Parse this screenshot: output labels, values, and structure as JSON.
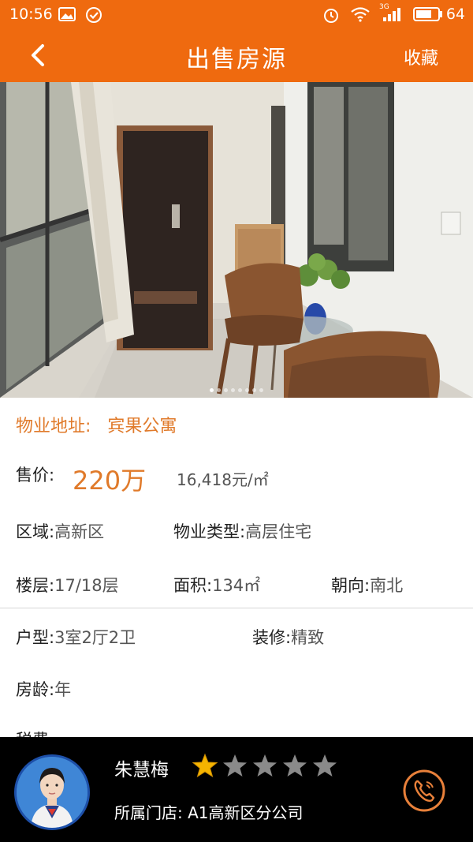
{
  "status_bar": {
    "time": "10:56",
    "network": "3G",
    "battery": "64"
  },
  "header": {
    "title": "出售房源",
    "favorite_label": "收藏",
    "back_icon": "chevron-left-icon",
    "color": "#ef6a0f"
  },
  "gallery": {
    "image_count": 8,
    "active_index": 1
  },
  "property": {
    "address_label": "物业地址:",
    "address_value": "宾果公寓",
    "price_label": "售价:",
    "price_value": "220万",
    "unit_price": "16,418元/㎡",
    "district_label": "区域:",
    "district_value": "高新区",
    "type_label": "物业类型:",
    "type_value": "高层住宅",
    "floor_label": "楼层:",
    "floor_value": "17/18层",
    "area_label": "面积:",
    "area_value": "134㎡",
    "orientation_label": "朝向:",
    "orientation_value": "南北",
    "layout_label": "户型:",
    "layout_value": "3室2厅2卫",
    "decoration_label": "装修:",
    "decoration_value": "精致",
    "age_label": "房龄:",
    "age_value": "年",
    "tax_label": "税费"
  },
  "agent": {
    "name": "朱慧梅",
    "rating": 1,
    "rating_max": 5,
    "store": "所属门店: A1高新区分公司",
    "call_icon": "phone-icon"
  },
  "colors": {
    "accent": "#ef6a0f",
    "label_orange": "#e07a2a",
    "star_gold": "#f5b400",
    "star_gray": "#8a8a8a"
  }
}
